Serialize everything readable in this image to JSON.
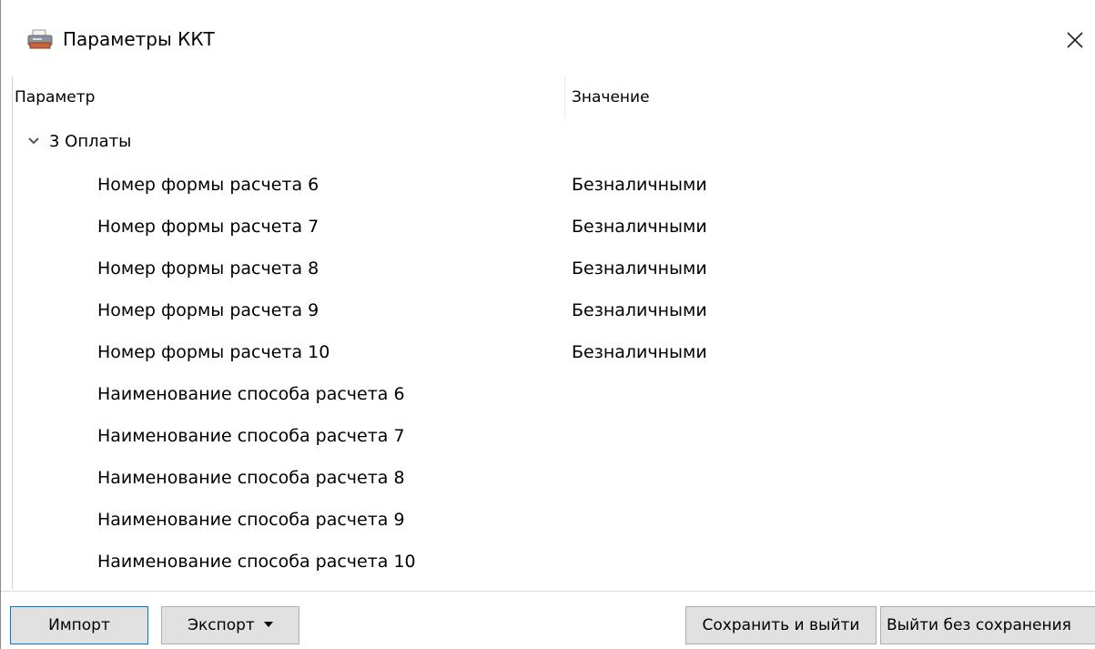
{
  "window": {
    "title": "Параметры ККТ",
    "close_glyph": "✕"
  },
  "grid": {
    "columns": [
      "Параметр",
      "Значение"
    ],
    "group": {
      "label": "3 Оплаты",
      "expanded": true
    },
    "rows": [
      {
        "name": "Номер формы расчета 6",
        "value": "Безналичными"
      },
      {
        "name": "Номер формы расчета 7",
        "value": "Безналичными"
      },
      {
        "name": "Номер формы расчета 8",
        "value": "Безналичными"
      },
      {
        "name": "Номер формы расчета 9",
        "value": "Безналичными"
      },
      {
        "name": "Номер формы расчета 10",
        "value": "Безналичными"
      },
      {
        "name": "Наименование способа расчета 6",
        "value": ""
      },
      {
        "name": "Наименование способа расчета 7",
        "value": ""
      },
      {
        "name": "Наименование способа расчета 8",
        "value": ""
      },
      {
        "name": "Наименование способа расчета 9",
        "value": ""
      },
      {
        "name": "Наименование способа расчета 10",
        "value": ""
      }
    ]
  },
  "buttons": {
    "import": "Импорт",
    "export": "Экспорт",
    "save_exit": "Сохранить и выйти",
    "exit_no_save": "Выйти без сохранения"
  },
  "icons": {
    "app": "printer-icon",
    "close": "close-icon",
    "expand": "chevron-down-icon",
    "dropdown": "dropdown-arrow-icon"
  },
  "colors": {
    "background": "#ffffff",
    "button_face": "#e1e1e1",
    "button_border": "#adadad",
    "focus_border": "#0078d7"
  }
}
